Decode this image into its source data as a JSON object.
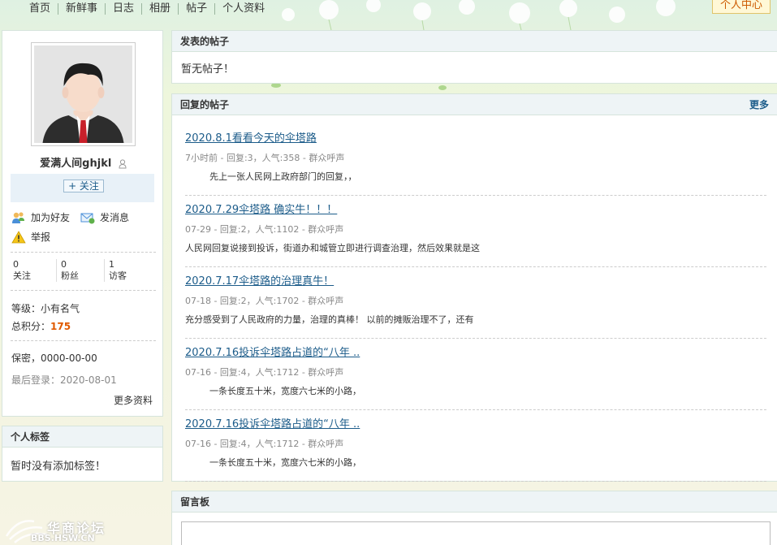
{
  "nav": {
    "items": [
      "首页",
      "新鲜事",
      "日志",
      "相册",
      "帖子",
      "个人资料"
    ],
    "user_center": "个人中心"
  },
  "profile": {
    "username": "爱满人间ghjkl",
    "follow_label": "+ 关注",
    "actions": {
      "add_friend": "加为好友",
      "send_message": "发消息",
      "report": "举报"
    },
    "stats": [
      {
        "count": "0",
        "label": "关注"
      },
      {
        "count": "0",
        "label": "粉丝"
      },
      {
        "count": "1",
        "label": "访客"
      }
    ],
    "level_label": "等级：",
    "level_value": "小有名气",
    "points_label": "总积分：",
    "points_value": "175",
    "privacy": "保密，0000-00-00",
    "last_login": "最后登录：2020-08-01",
    "more_info": "更多资料"
  },
  "tags": {
    "title": "个人标签",
    "empty": "暂时没有添加标签！"
  },
  "posts": {
    "title": "发表的帖子",
    "empty": "暂无帖子！"
  },
  "replies": {
    "title": "回复的帖子",
    "more": "更多",
    "items": [
      {
        "title": "2020.8.1看看今天的伞塔路",
        "meta": "7小时前 - 回复:3，人气:358 - 群众呼声",
        "snippet": "先上一张人民网上政府部门的回复，，"
      },
      {
        "title": "2020.7.29伞塔路 确实牛！！！",
        "meta": "07-29 - 回复:2，人气:1102 - 群众呼声",
        "snippet": "人民网回复说接到投诉，街道办和城管立即进行调查治理，然后效果就是这"
      },
      {
        "title": "2020.7.17伞塔路的治理真牛！",
        "meta": "07-18 - 回复:2，人气:1702 - 群众呼声",
        "snippet": "充分感受到了人民政府的力量，治理的真棒！ 以前的摊贩治理不了，还有"
      },
      {
        "title": "2020.7.16投诉伞塔路占道的“八年 ..",
        "meta": "07-16 - 回复:4，人气:1712 - 群众呼声",
        "snippet": "一条长度五十米，宽度六七米的小路，"
      },
      {
        "title": "2020.7.16投诉伞塔路占道的“八年 ..",
        "meta": "07-16 - 回复:4，人气:1712 - 群众呼声",
        "snippet": "一条长度五十米，宽度六七米的小路，"
      }
    ]
  },
  "board": {
    "title": "留言板"
  },
  "watermark": {
    "name": "华商论坛",
    "url": "BBS.HSW.CN"
  }
}
